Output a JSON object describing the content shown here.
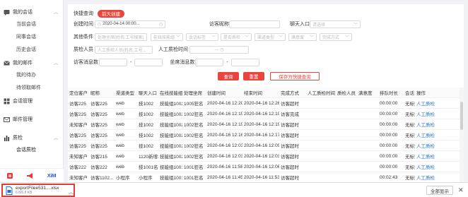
{
  "sidebar": {
    "groups": [
      {
        "label": "我的会话",
        "icon": "chat-icon",
        "items": [
          "当前会话",
          "同事会话",
          "历史会话"
        ]
      },
      {
        "label": "我的邮件",
        "icon": "mail-icon",
        "items": [
          "我的待办",
          "待领取邮件"
        ]
      },
      {
        "label": "会话管理",
        "icon": "grid-icon",
        "items": []
      },
      {
        "label": "邮件管理",
        "icon": "mailbox-icon",
        "items": []
      },
      {
        "label": "质检",
        "icon": "bar-chart-icon",
        "items": [
          "会话质检"
        ]
      }
    ],
    "bottom_icons": [
      "red-square-icon",
      "megaphone-icon",
      "xiaomi-logo-icon"
    ],
    "bottom_text": "XiM"
  },
  "filters": {
    "quick_query_label": "快捷查询",
    "quick_tag": "前天创建",
    "create_time_label": "创建时间",
    "create_time_value": "2020-04-14 00:00...",
    "visitor_name_label": "访客昵称",
    "chat_entry_label": "聊天入口",
    "chat_entry_placeholder": "请选择",
    "other_label": "其他条件",
    "other_placeholders": [
      "处理坐席(姓名,工号搜索)",
      "在线技能组",
      "会话标签",
      "是否质检",
      "渠道类型",
      "满意度",
      "完成方式"
    ],
    "qa_person_label": "质检人员",
    "qa_person_placeholder": "人工质检人员(姓名,工号...",
    "qa_time_label": "人工质检时间",
    "visitor_msg_label": "访客消息数",
    "agent_msg_label": "坐席消息数",
    "range_sep": "-",
    "buttons": {
      "query": "查询",
      "reset": "重置",
      "save": "保存为快捷查询"
    }
  },
  "table": {
    "headers": [
      "定位客户",
      "昵称",
      "渠道类型",
      "聊天入口",
      "在线技能组",
      "处理坐席",
      "创建时间",
      "结束时间",
      "完成方式",
      "人工质检时间",
      "质检人员",
      "满意度",
      "排队时长",
      "会话",
      "操作"
    ],
    "rows": [
      [
        "访客225",
        "访客225",
        "web",
        "技1002",
        "技能组1002",
        "1005狂名",
        "2020-04-16 12:20...",
        "2020-04-16 12:26...",
        "访客超时",
        "",
        "",
        "",
        "00:00:00",
        "无标签",
        "人工质检"
      ],
      [
        "访客225",
        "访客225",
        "web",
        "技1002",
        "技能组1002",
        "1002狂名",
        "2020-04-16 12:19...",
        "2020-04-16 12:19...",
        "访客完成",
        "",
        "",
        "",
        "00:00:00",
        "无标签",
        "人工质检"
      ],
      [
        "未知客户",
        "访客225",
        "web",
        "技1002",
        "技能组1002",
        "1002狂名",
        "2020-04-16 12:19...",
        "2020-04-16 12:19...",
        "访客超时",
        "",
        "",
        "",
        "00:00:00",
        "无标签",
        "人工质检"
      ],
      [
        "访客225",
        "访客225",
        "web",
        "技1002",
        "技能组1002",
        "1002狂名",
        "2020-04-16 12:16...",
        "2020-04-16 12:17...",
        "访客超时",
        "",
        "",
        "",
        "00:00:00",
        "无标签",
        "人工质检"
      ],
      [
        "访客225",
        "访客225",
        "web",
        "技1002",
        "技能组1002",
        "1002狂名",
        "2020-04-16 12:03...",
        "2020-04-16 12:09...",
        "访客超时",
        "",
        "",
        "",
        "00:00:00",
        "无标签",
        "人工质检"
      ],
      [
        "未知客户",
        "访客215",
        "web",
        "1120新增2",
        "技能组1002",
        "1002狂名",
        "2020-04-16 12:03...",
        "2020-04-16 12:03...",
        "访客超时",
        "",
        "",
        "",
        "00:00:00",
        "无标签",
        "人工质检"
      ],
      [
        "访客222",
        "访客222",
        "web",
        "技1001名...",
        "技能组1001",
        "1001狂名",
        "2020-04-16 11:58...",
        "2020-04-16 12:06...",
        "访客超时",
        "",
        "",
        "",
        "00:00:00",
        "无标签",
        "人工质检"
      ],
      [
        "未知客户",
        "访客1102...",
        "小程序",
        "小程序",
        "技能组1001",
        "1001狂名",
        "2020-04-16 11:45...",
        "2020-04-16 11:53...",
        "访客超时",
        "",
        "",
        "",
        "00:02:43",
        "无标签",
        "人工质检"
      ]
    ]
  },
  "download": {
    "filename": "exportFilee531....xlsx",
    "size": "6.8/6.8 KB",
    "show_all": "全部显示",
    "close": "✕"
  },
  "colors": {
    "accent": "#e8453c",
    "link": "#1f6fd0"
  }
}
